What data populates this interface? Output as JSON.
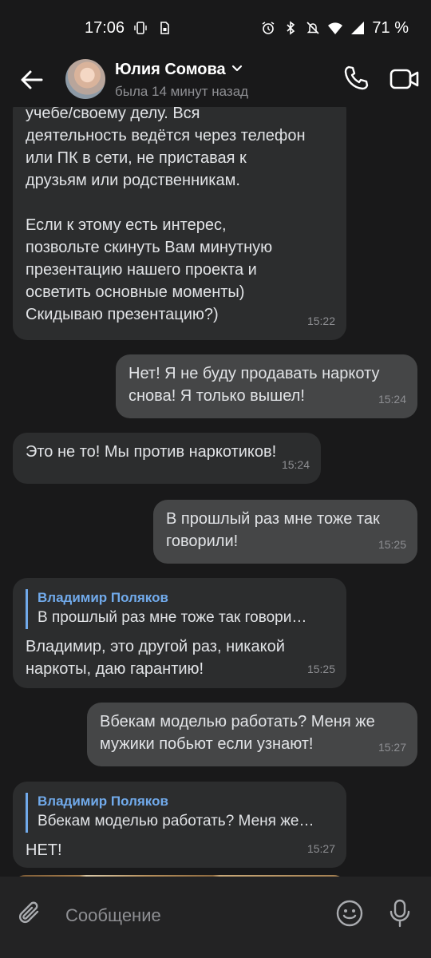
{
  "status_bar": {
    "time": "17:06",
    "battery": "71 %",
    "icons": [
      "phone-vibrate-icon",
      "sim-icon",
      "alarm-icon",
      "bluetooth-icon",
      "mute-icon",
      "wifi-icon",
      "signal-icon"
    ]
  },
  "header": {
    "name": "Юлия Сомова",
    "subtitle": "была 14 минут назад"
  },
  "messages": [
    {
      "dir": "in",
      "text": "учебе/своему делу. Вся\nдеятельность ведётся через телефон\nили ПК в сети, не приставая к\nдрузьям или родственникам.\n\nЕсли к этому есть интерес,\nпозвольте скинуть Вам минутную\nпрезентацию нашего проекта и\nосветить основные моменты)\nСкидываю презентацию?)",
      "time": "15:22"
    },
    {
      "dir": "out",
      "text": "Нет! Я не буду продавать наркоту\nснова! Я только вышел!",
      "time": "15:24"
    },
    {
      "dir": "in",
      "text": "Это не то! Мы против наркотиков!",
      "time": "15:24"
    },
    {
      "dir": "out",
      "text": "В прошлый раз мне тоже так\nговорили!",
      "time": "15:25"
    },
    {
      "dir": "in",
      "reply_author": "Владимир Поляков",
      "reply_text": "В прошлый раз мне тоже так говори…",
      "text": "Владимир, это другой раз, никакой\nнаркоты, даю гарантию!",
      "time": "15:25"
    },
    {
      "dir": "out",
      "text": "Вбекам моделью работать? Меня же\nмужики побьют если узнают!",
      "time": "15:27"
    },
    {
      "dir": "in",
      "reply_author": "Владимир Поляков",
      "reply_text": "Вбекам моделью работать? Меня же…",
      "text": "НЕТ!",
      "time": "15:27"
    }
  ],
  "composer": {
    "placeholder": "Сообщение"
  },
  "colors": {
    "background": "#19191a",
    "bubble_in": "#2c2d2e",
    "bubble_out": "#454647",
    "accent": "#71aaeb"
  }
}
